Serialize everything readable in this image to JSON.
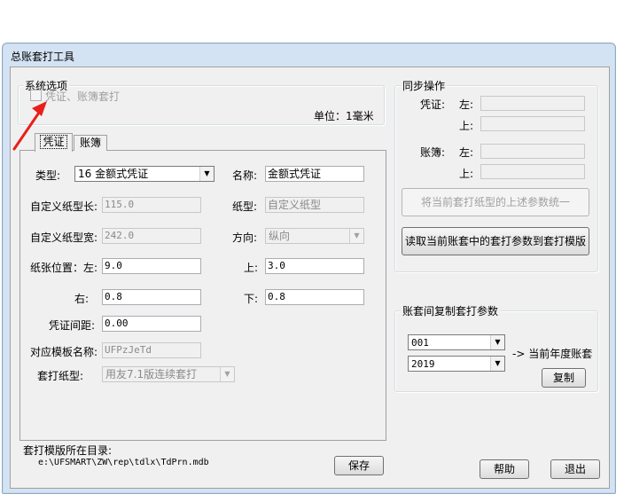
{
  "window": {
    "title": "总账套打工具"
  },
  "system_options": {
    "legend": "系统选项",
    "checkbox_label": "凭证、账簿套打",
    "unit_label": "单位：1毫米"
  },
  "tabs": {
    "voucher": "凭证",
    "ledger": "账簿"
  },
  "form": {
    "type_label": "类型:",
    "type_value": "16 金额式凭证",
    "name_label": "名称:",
    "name_value": "金额式凭证",
    "custom_len_label": "自定义纸型长:",
    "custom_len_value": "115.0",
    "paper_type_label": "纸型:",
    "paper_type_value": "自定义纸型",
    "custom_wid_label": "自定义纸型宽:",
    "custom_wid_value": "242.0",
    "direction_label": "方向:",
    "direction_value": "纵向",
    "left_label": "纸张位置：左:",
    "left_value": "9.0",
    "top_label": "上:",
    "top_value": "3.0",
    "right_label": "右:",
    "right_value": "0.8",
    "bottom_label": "下:",
    "bottom_value": "0.8",
    "gap_label": "凭证间距:",
    "gap_value": "0.00",
    "template_label": "对应模板名称:",
    "template_value": "UFPzJeTd",
    "print_type_label": "套打纸型:",
    "print_type_value": "用友7.1版连续套打"
  },
  "directory": {
    "label": "套打模版所在目录:",
    "path": "e:\\UFSMART\\ZW\\rep\\tdlx\\TdPrn.mdb"
  },
  "buttons": {
    "save": "保存",
    "unify": "将当前套打纸型的上述参数统一",
    "read": "读取当前账套中的套打参数到套打模版",
    "copy": "复制",
    "help": "帮助",
    "exit": "退出"
  },
  "sync": {
    "legend": "同步操作",
    "voucher_label": "凭证:",
    "ledger_label": "账簿:",
    "left": "左:",
    "top": "上:"
  },
  "copy_params": {
    "legend": "账套间复制套打参数",
    "account_value": "001",
    "year_value": "2019",
    "target_label": "-> 当前年度账套"
  },
  "colors": {
    "annotation_arrow": "#e8201a",
    "title_bar": "#d4e3f3"
  }
}
